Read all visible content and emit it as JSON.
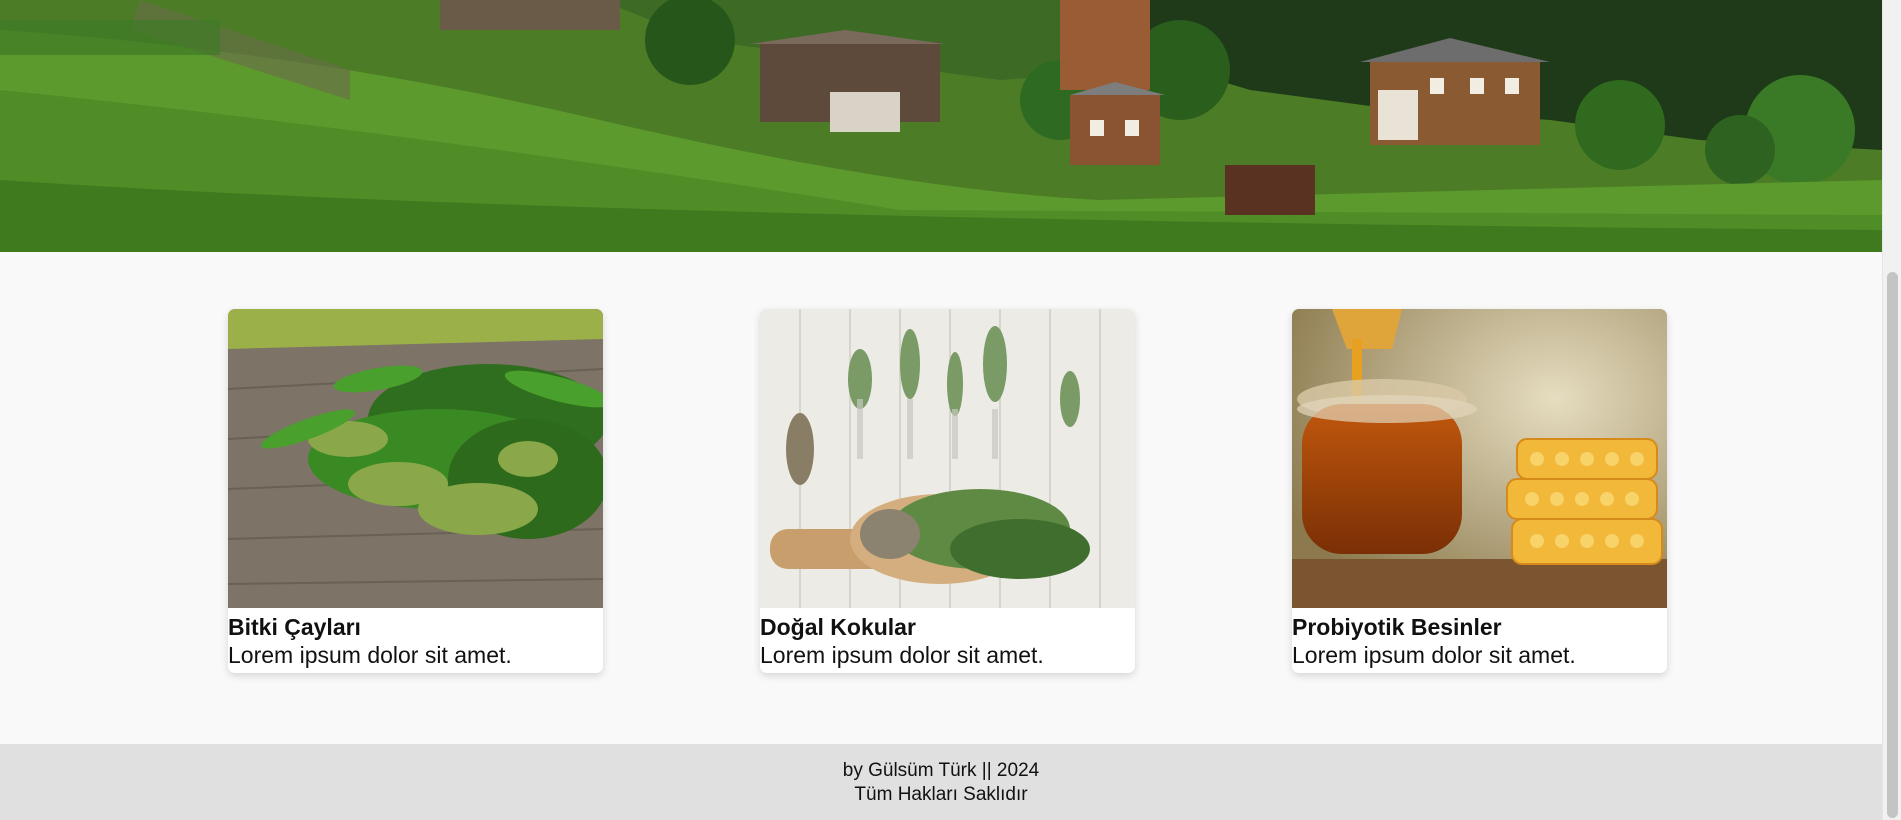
{
  "cards": [
    {
      "title": "Bitki Çayları",
      "description": "Lorem ipsum dolor sit amet.",
      "image_icon": "herb-bundle-image"
    },
    {
      "title": "Doğal Kokular",
      "description": "Lorem ipsum dolor sit amet.",
      "image_icon": "herb-sprigs-image"
    },
    {
      "title": "Probiyotik Besinler",
      "description": "Lorem ipsum dolor sit amet.",
      "image_icon": "honey-jar-image"
    }
  ],
  "footer": {
    "credit": "by Gülsüm Türk || 2024",
    "rights": "Tüm Hakları Saklıdır"
  },
  "colors": {
    "page_background": "#f9f9f9",
    "card_background": "#ffffff",
    "footer_background": "#e0e0e0",
    "hero_grass": "#5f9a2f"
  }
}
